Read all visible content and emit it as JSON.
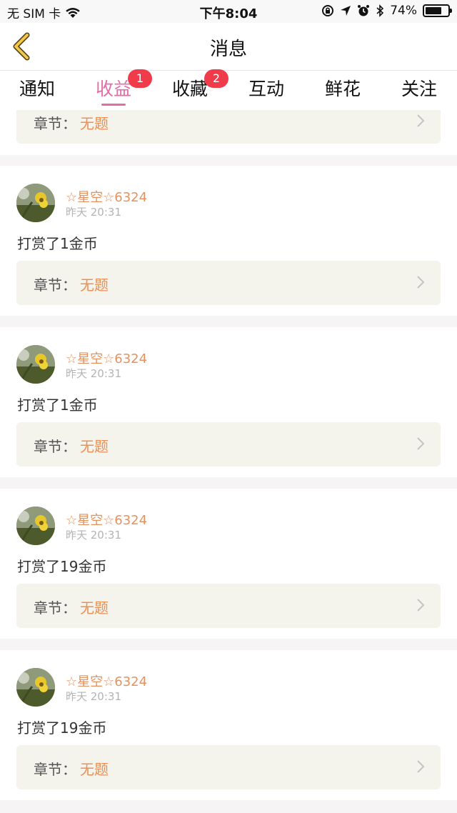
{
  "status_bar": {
    "carrier": "无 SIM 卡",
    "time": "下午8:04",
    "battery": "74%",
    "battery_level": 0.74
  },
  "nav": {
    "title": "消息"
  },
  "tabs": [
    {
      "label": "通知",
      "badge": ""
    },
    {
      "label": "收益",
      "badge": "1"
    },
    {
      "label": "收藏",
      "badge": "2"
    },
    {
      "label": "互动",
      "badge": ""
    },
    {
      "label": "鲜花",
      "badge": ""
    },
    {
      "label": "关注",
      "badge": ""
    }
  ],
  "active_tab": "收益",
  "colors": {
    "accent": "#e56ca6",
    "badge": "#f03c4a",
    "user_name": "#e3925f",
    "chapter_value": "#ec8f55"
  },
  "partial_card": {
    "chapter_label": "章节：",
    "chapter_value": "无题"
  },
  "cards": [
    {
      "user": "☆星空☆6324",
      "time": "昨天 20:31",
      "message": "打赏了1金币",
      "chapter_label": "章节：",
      "chapter_value": "无题"
    },
    {
      "user": "☆星空☆6324",
      "time": "昨天 20:31",
      "message": "打赏了1金币",
      "chapter_label": "章节：",
      "chapter_value": "无题"
    },
    {
      "user": "☆星空☆6324",
      "time": "昨天 20:31",
      "message": "打赏了19金币",
      "chapter_label": "章节：",
      "chapter_value": "无题"
    },
    {
      "user": "☆星空☆6324",
      "time": "昨天 20:31",
      "message": "打赏了19金币",
      "chapter_label": "章节：",
      "chapter_value": "无题"
    }
  ]
}
